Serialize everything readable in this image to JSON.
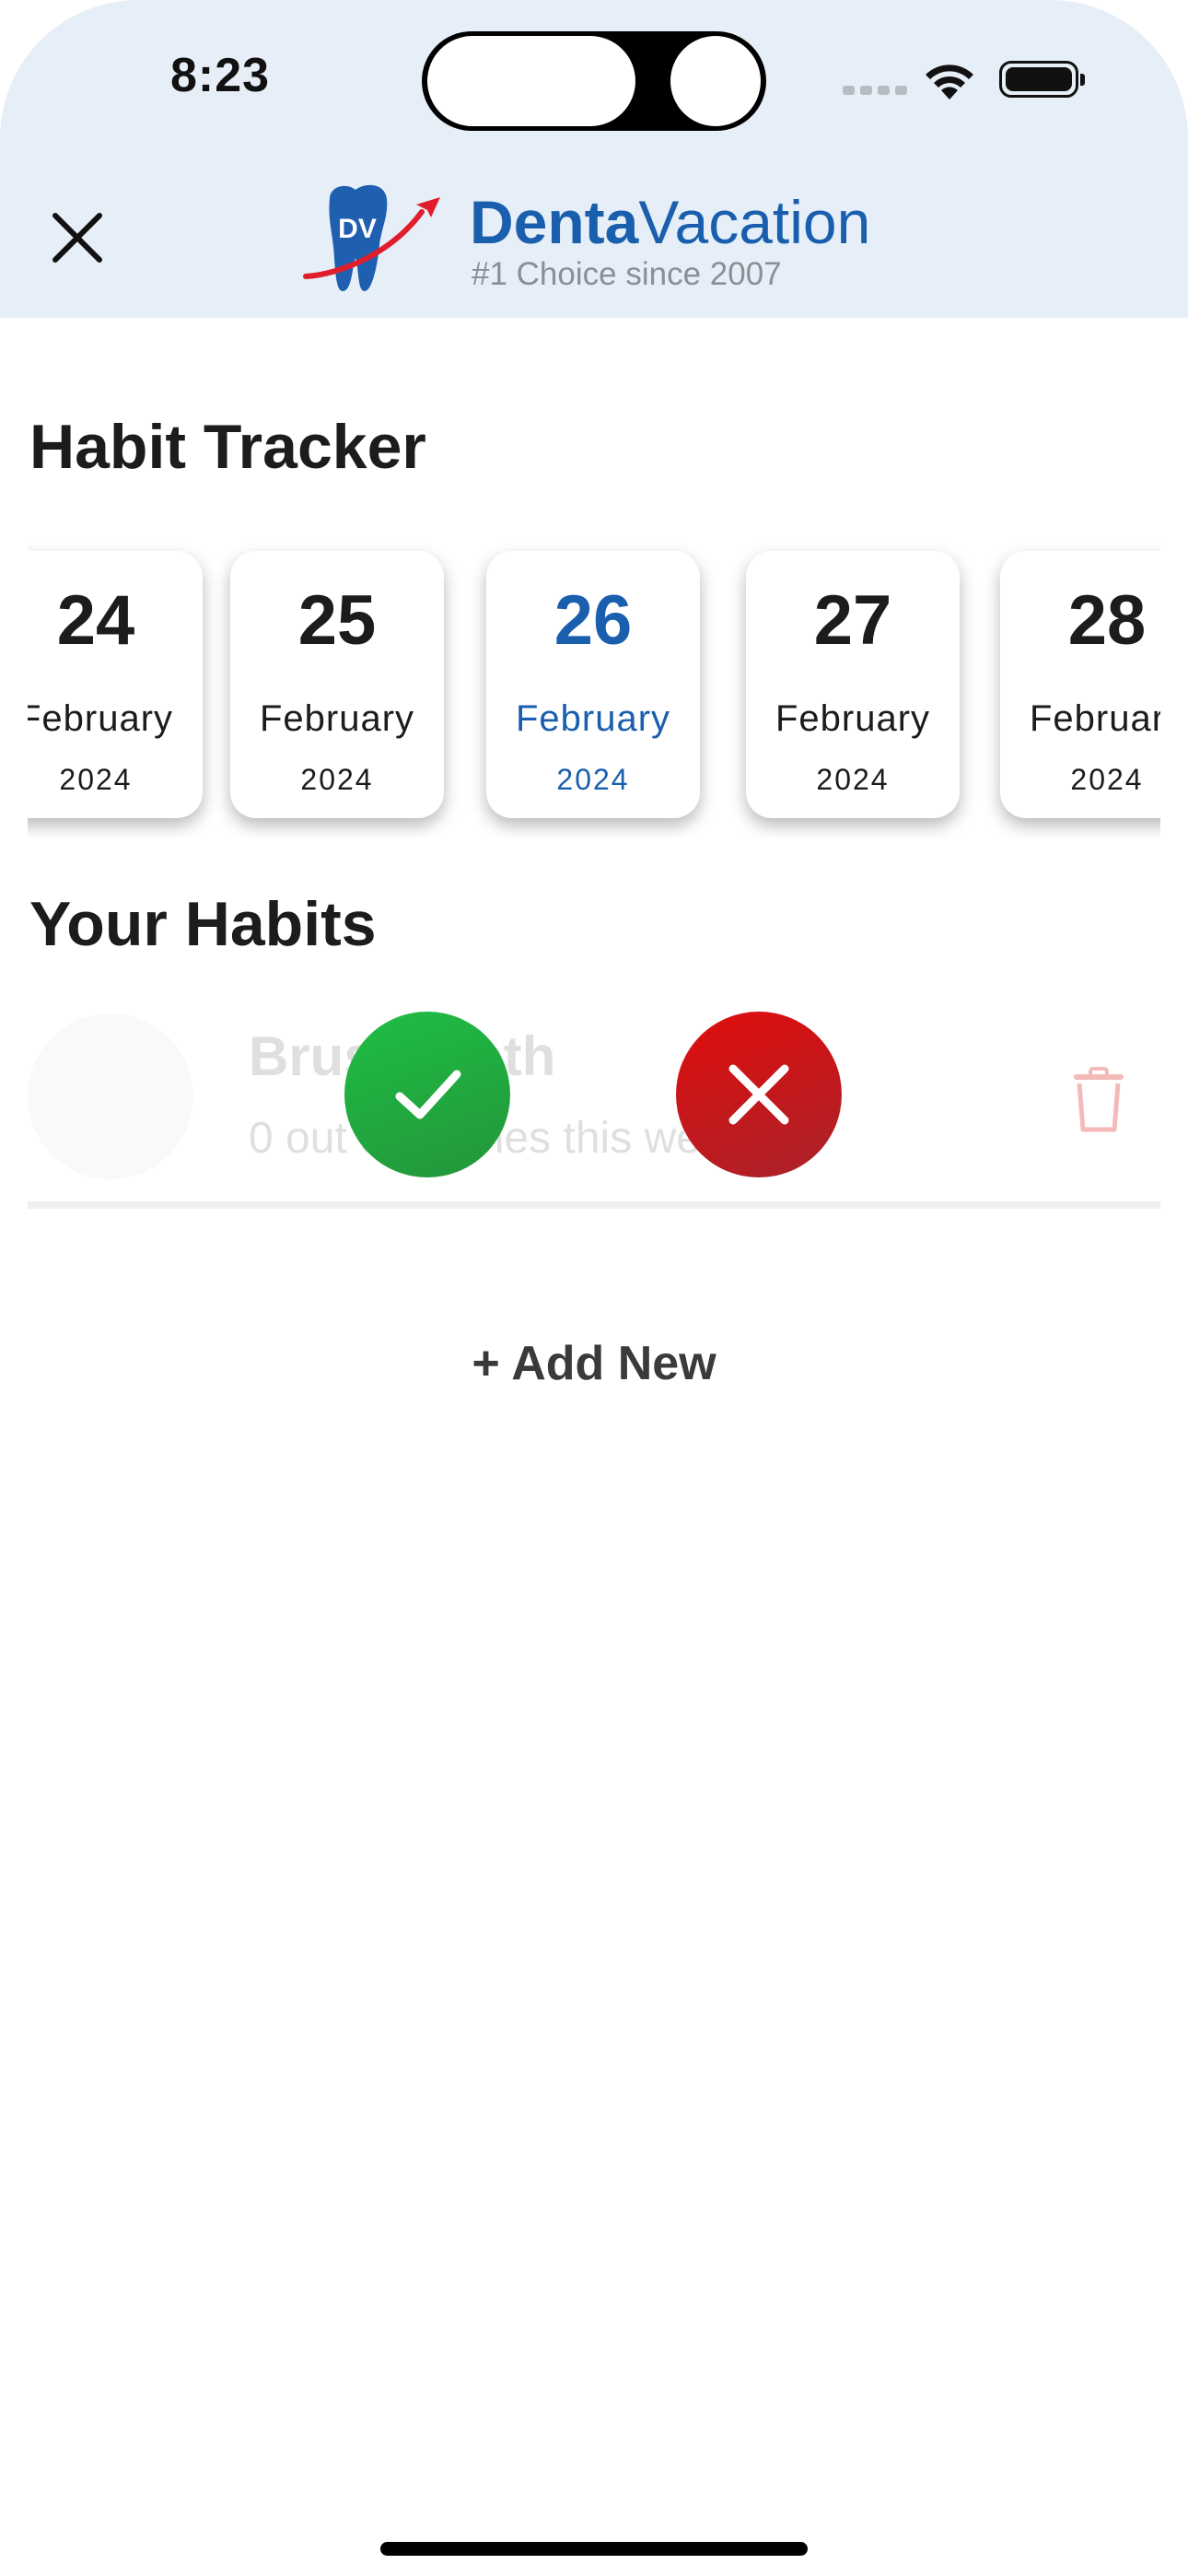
{
  "status_bar": {
    "time": "8:23",
    "icons": [
      "signal-icon",
      "wifi-icon",
      "battery-icon"
    ]
  },
  "header": {
    "close_icon": "close-icon",
    "logo_initials": "DV",
    "brand_bold": "Denta",
    "brand_light": "Vacation",
    "tagline": "#1 Choice since 2007",
    "colors": {
      "header_bg": "#e6eef7",
      "brand": "#1a5fae",
      "logo_swoosh": "#e01e2b"
    }
  },
  "habit_tracker": {
    "title": "Habit Tracker",
    "dates": [
      {
        "day": "24",
        "month": "February",
        "year": "2024",
        "selected": false
      },
      {
        "day": "25",
        "month": "February",
        "year": "2024",
        "selected": false
      },
      {
        "day": "26",
        "month": "February",
        "year": "2024",
        "selected": true
      },
      {
        "day": "27",
        "month": "February",
        "year": "2024",
        "selected": false
      },
      {
        "day": "28",
        "month": "February",
        "year": "2024",
        "selected": false
      }
    ],
    "selected_color": "#1a5fae"
  },
  "habits": {
    "title": "Your Habits",
    "items": [
      {
        "name": "Brush teeth",
        "progress": "0 out of 7 times this week",
        "actions": {
          "complete_icon": "check-icon",
          "skip_icon": "x-icon",
          "delete_icon": "trash-icon"
        },
        "colors": {
          "complete": "#22a93f",
          "skip": "#d0141a"
        }
      }
    ],
    "add_new_label": "+ Add New"
  }
}
